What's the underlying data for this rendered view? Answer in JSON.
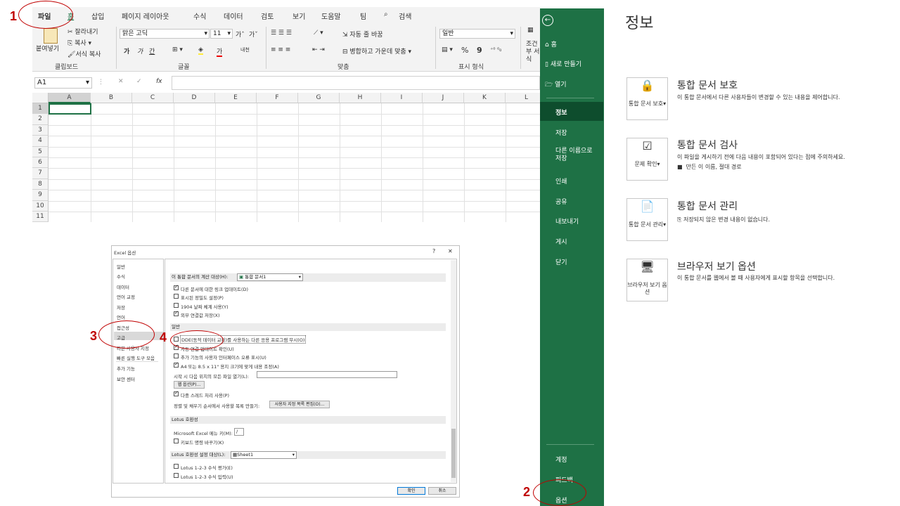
{
  "ribbon_tabs": [
    "파일",
    "홈",
    "삽입",
    "페이지 레이아웃",
    "수식",
    "데이터",
    "검토",
    "보기",
    "도움말",
    "팀",
    "검색"
  ],
  "clipboard": {
    "paste": "붙여넣기",
    "cut": "잘라내기",
    "copy": "복사",
    "format_painter": "서식 복사",
    "group": "클립보드"
  },
  "font": {
    "name": "맑은 고딕",
    "size": "11",
    "grow": "가ˆ",
    "shrink": "가ˇ",
    "bold": "가",
    "italic": "가",
    "underline": "간",
    "font_color": "가",
    "phonetic": "내천",
    "group": "글꼴"
  },
  "align": {
    "wrap": "자동 줄 바꿈",
    "merge": "병합하고 가운데 맞춤",
    "group": "맞춤"
  },
  "number": {
    "format": "일반",
    "percent": "%",
    "comma": "9",
    "group": "표시 형식",
    "cond_fmt": "조건부 서식"
  },
  "formula_bar": {
    "name_box": "A1",
    "fx": "fx"
  },
  "columns": [
    "A",
    "B",
    "C",
    "D",
    "E",
    "F",
    "G",
    "H",
    "I",
    "J",
    "K",
    "L"
  ],
  "rows": [
    "1",
    "2",
    "3",
    "4",
    "5",
    "6",
    "7",
    "8",
    "9",
    "10",
    "11"
  ],
  "backstage": {
    "home": "홈",
    "new": "새로 만들기",
    "open": "열기",
    "items": [
      "정보",
      "저장",
      "다른 이름으로 저장",
      "인쇄",
      "공유",
      "내보내기",
      "게시",
      "닫기"
    ],
    "account": "계정",
    "feedback": "피드백",
    "options": "옵션"
  },
  "info": {
    "title": "정보",
    "sections": [
      {
        "title": "통합 문서 보호",
        "desc": "이 통합 문서에서 다른 사용자들이 변경할 수 있는 내용을 제어합니다.",
        "btn": "통합 문서 보호▾"
      },
      {
        "title": "통합 문서 검사",
        "desc": "이 파일을 게시하기 전에 다음 내용이 포함되어 있다는 점에 주의하세요.",
        "bullet": "만든 이 이름, 절대 경로",
        "btn": "문제 확인▾"
      },
      {
        "title": "통합 문서 관리",
        "desc": "저장되지 않은 변경 내용이 없습니다.",
        "btn": "통합 문서 관리▾"
      },
      {
        "title": "브라우저 보기 옵션",
        "desc": "이 통합 문서를 웹에서 볼 때 사용자에게 표시할 항목을 선택합니다.",
        "btn": "브라우저 보기 옵션"
      }
    ]
  },
  "dialog": {
    "title": "Excel 옵션",
    "help": "?",
    "close": "✕",
    "nav": [
      "일반",
      "수식",
      "데이터",
      "언어 교정",
      "저장",
      "언어",
      "접근성",
      "고급",
      "리본 사용자 지정",
      "빠른 실행 도구 모음",
      "추가 기능",
      "보안 센터"
    ],
    "calc_label": "이 통합 문서의 계산 대상(H):",
    "calc_value": "통합 문서1",
    "calc_opts": [
      "다른 문서에 대한 링크 업데이트(D)",
      "표시된 정밀도 설정(P)",
      "1904 날짜 체계 사용(Y)",
      "외부 연결값 저장(X)"
    ],
    "general": "일반",
    "gen_opts": [
      "DDE(동적 데이터 교환)를 사용하는 다른 응용 프로그램 무시(O)",
      "자동 연결 업데이트 확인(U)",
      "추가 기능의 사용자 인터페이스 오류 표시(U)",
      "A4 또는 8.5 x 11\" 용지 크기에 맞게 내용 조정(A)"
    ],
    "startup": "시작 시 다음 위치의 모든 파일 열기(L):",
    "web_options": "웹 옵션(P)...",
    "multithread": "다중 스레드 처리 사용(P)",
    "sortlist": "정렬 및 채우기 순서에서 사용할 목록 만들기:",
    "sortlist_btn": "사용자 지정 목록 편집(O)...",
    "lotus": "Lotus 호환성",
    "menu_key": "Microsoft Excel 메뉴 키(M):",
    "menu_key_val": "/",
    "nav_keys": "키보드 명령 바꾸기(K)",
    "lotus_target": "Lotus 호환성 설정 대상(L):",
    "lotus_sheet": "Sheet1",
    "lotus_opts": [
      "Lotus 1-2-3 수식 평가(E)",
      "Lotus 1-2-3 수식 입력(U)"
    ],
    "ok": "확인",
    "cancel": "취소"
  },
  "steps": [
    "1",
    "2",
    "3",
    "4"
  ]
}
